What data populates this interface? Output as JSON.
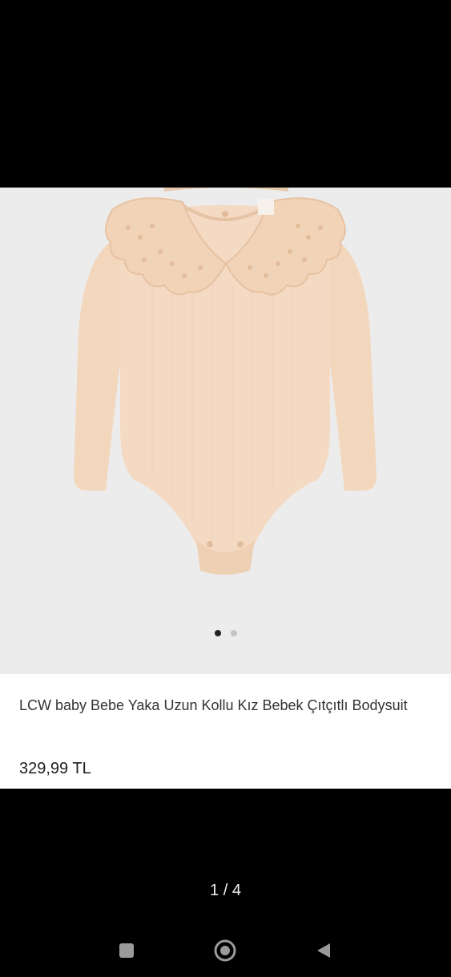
{
  "product": {
    "title": "LCW baby Bebe Yaka Uzun Kollu Kız Bebek Çıtçıtlı Bodysuit",
    "price": "329,99 TL",
    "image_description_icon": "bodysuit-image"
  },
  "gallery": {
    "dot_count": 2,
    "active_dot": 0
  },
  "viewer": {
    "counter": "1 / 4"
  },
  "navigation": {
    "recents_icon": "square-icon",
    "home_icon": "circle-icon",
    "back_icon": "triangle-back-icon"
  },
  "colors": {
    "background": "#000000",
    "card": "#ffffff",
    "image_bg": "#ececec",
    "garment": "#f3d7bd",
    "active_dot": "#222222",
    "inactive_dot": "#c4c4c4"
  }
}
